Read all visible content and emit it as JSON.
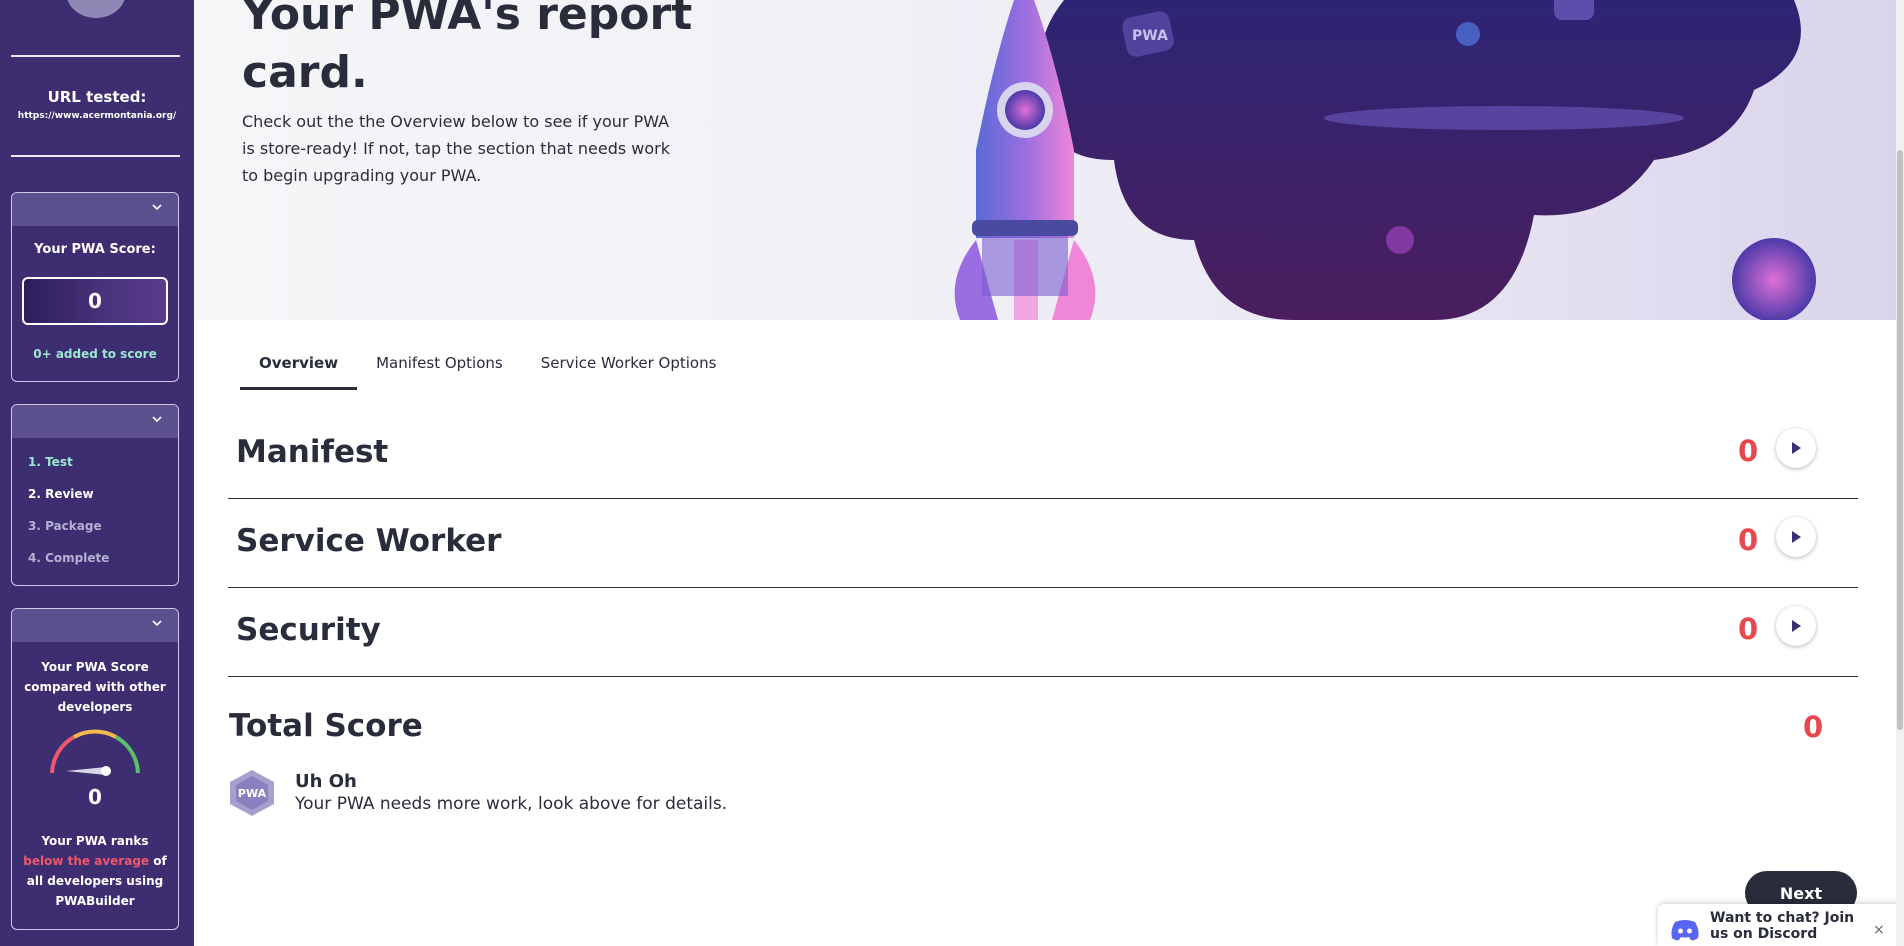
{
  "sidebar": {
    "url_label": "URL tested:",
    "url_value": "https://www.acermontania.org/",
    "score_card": {
      "title": "Your PWA Score:",
      "score": "0",
      "added": "0+ added to score"
    },
    "steps": [
      {
        "label": "1. Test",
        "state": "active"
      },
      {
        "label": "2. Review",
        "state": "current"
      },
      {
        "label": "3. Package",
        "state": "todo"
      },
      {
        "label": "4. Complete",
        "state": "todo"
      }
    ],
    "compare": {
      "title": "Your PWA Score compared with other developers",
      "gauge_value": "0",
      "rank_prefix": "Your PWA ranks ",
      "rank_highlight": "below the average",
      "rank_suffix": " of all developers using PWABuilder"
    }
  },
  "hero": {
    "title_line1": "Your PWA's report",
    "title_line2": "card.",
    "description": "Check out the the Overview below to see if your PWA is store-ready! If not, tap the section that needs work to begin upgrading your PWA.",
    "art_label": "PWA"
  },
  "tabs": [
    {
      "label": "Overview",
      "selected": true
    },
    {
      "label": "Manifest Options",
      "selected": false
    },
    {
      "label": "Service Worker Options",
      "selected": false
    }
  ],
  "sections": [
    {
      "name": "Manifest",
      "score": "0"
    },
    {
      "name": "Service Worker",
      "score": "0"
    },
    {
      "name": "Security",
      "score": "0"
    }
  ],
  "total": {
    "label": "Total Score",
    "score": "0"
  },
  "result": {
    "badge_text": "PWA",
    "title": "Uh Oh",
    "message": "Your PWA needs more work, look above for details."
  },
  "next_label": "Next",
  "discord": {
    "text": "Want to chat? Join us on Discord",
    "close": "×"
  },
  "colors": {
    "sidebar": "#3c2e70",
    "accent_red": "#e5484d",
    "accent_teal": "#9be7d1",
    "dark": "#292c3a"
  }
}
